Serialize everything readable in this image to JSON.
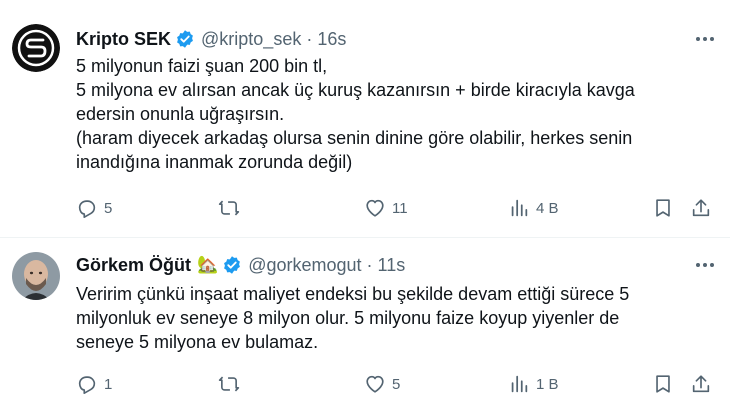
{
  "tweets": [
    {
      "author_name": "Kripto SEK",
      "handle": "@kripto_sek",
      "separator": "·",
      "time": "16s",
      "emoji": "",
      "text_lines": [
        "5 milyonun faizi şuan 200 bin tl,",
        "5 milyona ev alırsan ancak üç kuruş kazanırsın + birde kiracıyla kavga",
        "edersin onunla uğraşırsın.",
        "(haram diyecek arkadaş olursa senin dinine göre olabilir, herkes senin",
        "inandığına inanmak zorunda değil)"
      ],
      "replies": "5",
      "retweets": "",
      "likes": "11",
      "views": "4 B",
      "avatar_icon": "kripto-sek-logo"
    },
    {
      "author_name": "Görkem Öğüt",
      "handle": "@gorkemogut",
      "separator": "·",
      "time": "11s",
      "emoji": "🏡",
      "text_lines": [
        "Veririm çünkü inşaat maliyet endeksi bu şekilde devam ettiği sürece 5",
        "milyonluk ev seneye 8 milyon olur. 5 milyonu faize koyup yiyenler de",
        "seneye 5 milyona ev bulamaz."
      ],
      "replies": "1",
      "retweets": "",
      "likes": "5",
      "views": "1 B",
      "avatar_icon": "profile-photo"
    }
  ],
  "colors": {
    "text": "#0f1419",
    "muted": "#536471",
    "verified": "#1d9bf0",
    "divider": "#eff3f4"
  }
}
